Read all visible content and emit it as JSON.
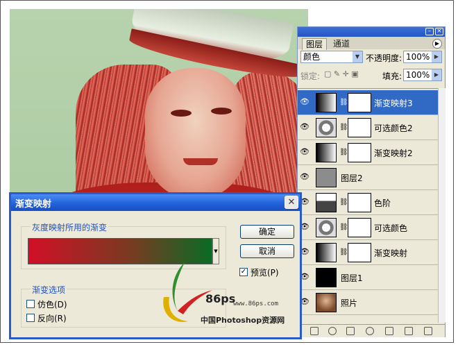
{
  "layers_panel": {
    "tab_layers": "图层",
    "tab_channels": "通道",
    "blend_mode": "颜色",
    "opacity_label": "不透明度:",
    "opacity_value": "100%",
    "lock_label": "锁定:",
    "fill_label": "填充:",
    "fill_value": "100%",
    "layers": [
      {
        "name": "渐变映射3",
        "selected": true,
        "has_mask": true,
        "thumb": "gradient-map"
      },
      {
        "name": "可选颜色2",
        "selected": false,
        "has_mask": true,
        "thumb": "selective-color"
      },
      {
        "name": "渐变映射2",
        "selected": false,
        "has_mask": true,
        "thumb": "gradient-map"
      },
      {
        "name": "图层2",
        "selected": false,
        "has_mask": false,
        "thumb": "gray-fill"
      },
      {
        "name": "色阶",
        "selected": false,
        "has_mask": true,
        "thumb": "levels"
      },
      {
        "name": "可选颜色",
        "selected": false,
        "has_mask": true,
        "thumb": "selective-color"
      },
      {
        "name": "渐变映射",
        "selected": false,
        "has_mask": true,
        "thumb": "gradient-map"
      },
      {
        "name": "图层1",
        "selected": false,
        "has_mask": false,
        "thumb": "black-fill"
      },
      {
        "name": "照片",
        "selected": false,
        "has_mask": false,
        "thumb": "photo"
      }
    ]
  },
  "dialog": {
    "title": "渐变映射",
    "group_gradient": "灰度映射所用的渐变",
    "ok": "确定",
    "cancel": "取消",
    "preview": "预览(P)",
    "preview_checked": true,
    "group_options": "渐变选项",
    "dither": "仿色(D)",
    "reverse": "反向(R)",
    "gradient_colors": [
      "#d10f26",
      "#0a6b24"
    ]
  },
  "watermark": {
    "logo_text": "86ps",
    "url": "www.86ps.com",
    "site_name": "中国Photoshop资源网"
  }
}
